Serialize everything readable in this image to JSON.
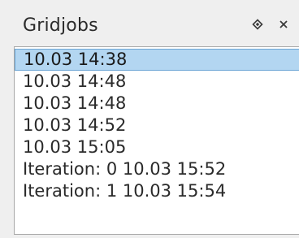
{
  "window": {
    "title": "Gridjobs",
    "float_icon": "diamond-float-icon",
    "close_icon": "close-icon"
  },
  "list": {
    "selected_index": 0,
    "items": [
      "10.03 14:38",
      "10.03 14:48",
      "10.03 14:48",
      "10.03 14:52",
      "10.03 15:05",
      "Iteration: 0 10.03 15:52",
      "Iteration: 1 10.03 15:54"
    ]
  },
  "colors": {
    "selection": "#b3d6f1",
    "selection_border": "#6aa4d4",
    "panel_bg": "#efefef"
  }
}
